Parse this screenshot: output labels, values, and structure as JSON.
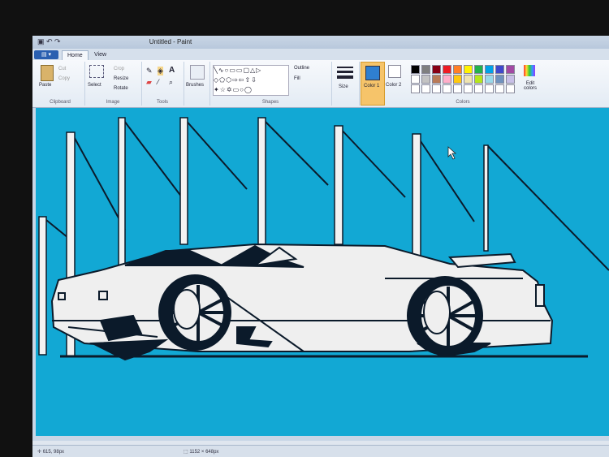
{
  "window": {
    "title": "Untitled - Paint"
  },
  "tabs": [
    {
      "label": "Home"
    },
    {
      "label": "View"
    }
  ],
  "clipboard": {
    "paste": "Paste",
    "cut": "Cut",
    "copy": "Copy",
    "label": "Clipboard"
  },
  "image": {
    "select": "Select",
    "crop": "Crop",
    "resize": "Resize",
    "rotate": "Rotate",
    "label": "Image"
  },
  "tools": {
    "label": "Tools"
  },
  "brushes": {
    "label": "Brushes"
  },
  "shapes": {
    "outline": "Outline",
    "fill": "Fill",
    "label": "Shapes"
  },
  "size": {
    "label": "Size"
  },
  "color1": {
    "label": "Color 1",
    "value": "#2f7fd0"
  },
  "color2": {
    "label": "Color 2",
    "value": "#ffffff"
  },
  "colors": {
    "label": "Colors",
    "edit": "Edit colors",
    "palette": [
      "#000000",
      "#7f7f7f",
      "#880015",
      "#ed1c24",
      "#ff7f27",
      "#fff200",
      "#22b14c",
      "#00a2e8",
      "#3f48cc",
      "#a349a4",
      "#ffffff",
      "#c3c3c3",
      "#b97a57",
      "#ffaec9",
      "#ffc90e",
      "#efe4b0",
      "#b5e61d",
      "#99d9ea",
      "#7092be",
      "#c8bfe7"
    ]
  },
  "canvas": {
    "background": "#12a8d4"
  },
  "status": {
    "coords": "615, 98px",
    "size": "1152 × 648px"
  }
}
